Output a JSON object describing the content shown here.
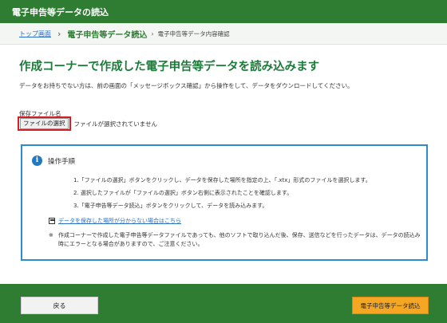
{
  "header": {
    "title": "電子申告等データの読込"
  },
  "breadcrumb": {
    "home": "トップ画面",
    "current": "電子申告等データ読込",
    "next": "電子申告等データ内容確認"
  },
  "main": {
    "title": "作成コーナーで作成した電子申告等データを読み込みます",
    "description": "データをお持ちでない方は、前の画面の「メッセージボックス確認」から操作をして、データをダウンロードしてください。",
    "file_label": "保存ファイル名",
    "file_button": "ファイルの選択",
    "no_file_text": "ファイルが選択されていません"
  },
  "info": {
    "title": "操作手順",
    "steps": [
      "1.「ファイルの選択」ボタンをクリックし、データを保存した場所を指定の上、「.xtx」形式のファイルを選択します。",
      "2. 選択したファイルが「ファイルの選択」ボタン右側に表示されたことを確認します。",
      "3.「電子申告等データ読込」ボタンをクリックして、データを読み込みます。"
    ],
    "link": "データを保存した場所が分からない場合はこちら",
    "note_mark": "※",
    "note": "作成コーナーで作成した電子申告等データファイルであっても、他のソフトで取り込んだ後、保存、送信などを行ったデータは、データの読込み時にエラーとなる場合がありますので、ご注意ください。"
  },
  "footer": {
    "back_label": "戻る",
    "read_label": "電子申告等データ読込"
  },
  "colors": {
    "brand_green": "#2e7d32",
    "title_green": "#1e7a3a",
    "info_blue": "#2d8bd1",
    "highlight_red": "#d32027",
    "action_orange": "#f5a623"
  }
}
